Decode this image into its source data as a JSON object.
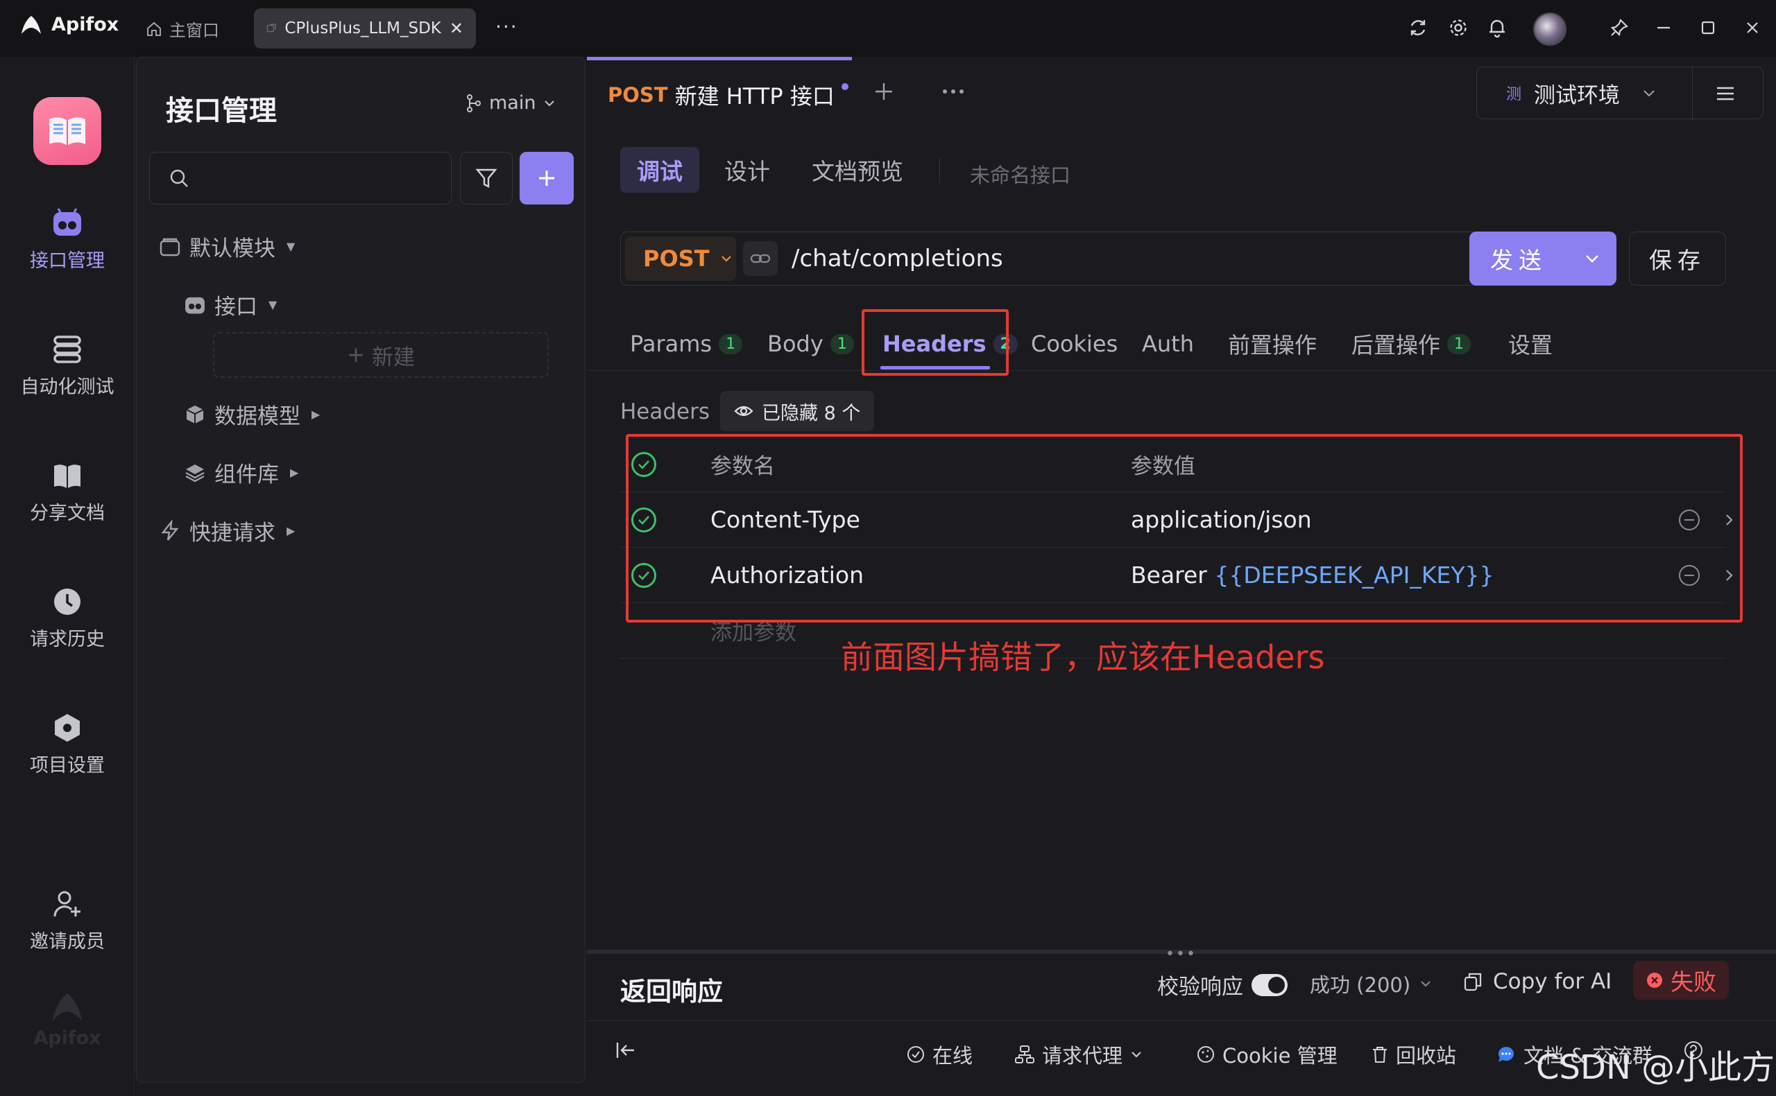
{
  "titlebar": {
    "app_name": "Apifox",
    "home_tab": "主窗口",
    "project_tab": "CPlusPlus_LLM_SDK",
    "more": "···"
  },
  "rail": {
    "items": [
      {
        "label": "接口管理",
        "icon": "api-icon",
        "active": true
      },
      {
        "label": "自动化测试",
        "icon": "automation-icon",
        "active": false
      },
      {
        "label": "分享文档",
        "icon": "book-icon",
        "active": false
      },
      {
        "label": "请求历史",
        "icon": "clock-icon",
        "active": false
      },
      {
        "label": "项目设置",
        "icon": "hexagon-settings-icon",
        "active": false
      }
    ],
    "invite": "邀请成员",
    "watermark": "Apifox"
  },
  "panel": {
    "title": "接口管理",
    "branch": "main",
    "tree": {
      "default_module": "默认模块",
      "api": "接口",
      "new": "新建",
      "data_model": "数据模型",
      "components": "组件库",
      "quick_request": "快捷请求"
    }
  },
  "main": {
    "tab": {
      "method": "POST",
      "name": "新建 HTTP 接口"
    },
    "environment": {
      "badge": "测",
      "label": "测试环境"
    },
    "subtabs": [
      "调试",
      "设计",
      "文档预览"
    ],
    "unnamed": "未命名接口",
    "request": {
      "method": "POST",
      "url": "/chat/completions",
      "send": "发送",
      "save": "保存"
    },
    "request_tabs": [
      {
        "label": "Params",
        "count": "1"
      },
      {
        "label": "Body",
        "count": "1"
      },
      {
        "label": "Headers",
        "count": "2"
      },
      {
        "label": "Cookies"
      },
      {
        "label": "Auth"
      },
      {
        "label": "前置操作"
      },
      {
        "label": "后置操作",
        "count": "1"
      },
      {
        "label": "设置"
      }
    ],
    "headers_section": {
      "label": "Headers",
      "hidden": "已隐藏 8 个",
      "col_name": "参数名",
      "col_value": "参数值",
      "rows": [
        {
          "name": "Content-Type",
          "value": "application/json",
          "variable": ""
        },
        {
          "name": "Authorization",
          "value": "Bearer ",
          "variable": "{{DEEPSEEK_API_KEY}}"
        }
      ],
      "add_param": "添加参数"
    },
    "annotation": "前面图片搞错了，应该在Headers",
    "response": {
      "title": "返回响应",
      "validate": "校验响应",
      "status": "成功 (200)",
      "copy_ai": "Copy for AI",
      "fail": "失败"
    },
    "statusbar": {
      "online": "在线",
      "proxy": "请求代理",
      "cookie": "Cookie 管理",
      "trash": "回收站",
      "docs": "文档 & 交流群"
    },
    "watermark": "CSDN @小此方"
  },
  "colors": {
    "accent": "#8c7ff0",
    "post": "#f08a3c",
    "success": "#3dbf6a",
    "annotation_red": "#e53935",
    "variable_blue": "#6ea8fe"
  }
}
